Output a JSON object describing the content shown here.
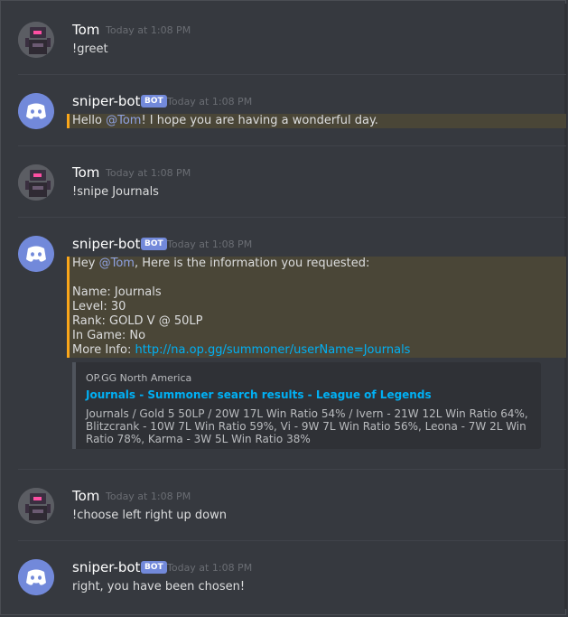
{
  "messages": [
    {
      "author": "Tom",
      "timestamp": "Today at 1:08 PM",
      "text": "!greet"
    },
    {
      "author": "sniper-bot",
      "bot_tag": "BOT",
      "timestamp": "Today at 1:08 PM",
      "parts": [
        "Hello ",
        "@Tom",
        "! I hope you are having a wonderful day."
      ]
    },
    {
      "author": "Tom",
      "timestamp": "Today at 1:08 PM",
      "text": "!snipe Journals"
    },
    {
      "author": "sniper-bot",
      "bot_tag": "BOT",
      "timestamp": "Today at 1:08 PM",
      "line1": [
        "Hey ",
        "@Tom",
        ", Here is the information you requested:"
      ],
      "info": {
        "name": "Name: Journals",
        "level": "Level: 30",
        "rank": "Rank: GOLD V @ 50LP",
        "in_game": "In Game: No",
        "more_info_label": "More Info: ",
        "more_info_url": "http://na.op.gg/summoner/userName=Journals"
      },
      "embed": {
        "provider": "OP.GG North America",
        "title": "Journals - Summoner search results - League of Legends",
        "description": "Journals / Gold 5 50LP / 20W 17L Win Ratio 54% / Ivern - 21W 12L Win Ratio 64%, Blitzcrank - 10W 7L Win Ratio 59%, Vi - 9W 7L Win Ratio 56%, Leona - 7W 2L Win Ratio 78%, Karma - 3W 5L Win Ratio 38%"
      }
    },
    {
      "author": "Tom",
      "timestamp": "Today at 1:08 PM",
      "text": "!choose left right up down"
    },
    {
      "author": "sniper-bot",
      "bot_tag": "BOT",
      "timestamp": "Today at 1:08 PM",
      "text": "right, you have been chosen!"
    }
  ],
  "colors": {
    "background": "#36393f",
    "mention": "#8ea1e1",
    "link": "#00b0f4",
    "highlight": "#faa61a",
    "blurple": "#7289da"
  },
  "icons": {
    "tom_avatar": "robot-avatar-icon",
    "bot_avatar": "discord-logo-icon"
  }
}
